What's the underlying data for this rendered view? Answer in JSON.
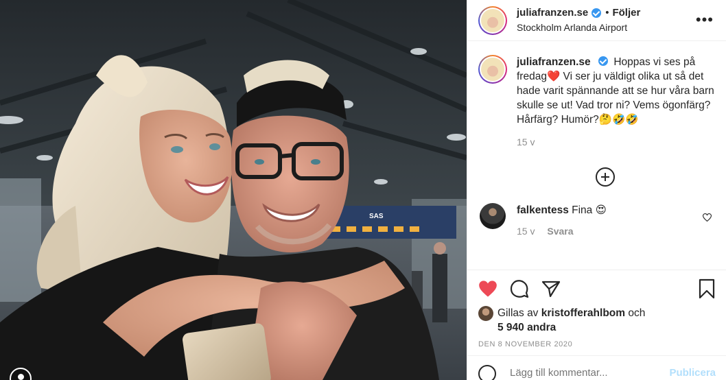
{
  "post": {
    "username": "juliafranzen.se",
    "separator": "•",
    "follow_label": "Följer",
    "location": "Stockholm Arlanda Airport",
    "more_icon": "more-options-icon"
  },
  "caption": {
    "username": "juliafranzen.se",
    "text": "Hoppas vi ses på fredag❤️ Vi ser ju väldigt olika ut så det hade varit spännande att se hur våra barn skulle se ut! Vad tror ni? Vems ögonfärg? Hårfärg? Humör?🤔🤣🤣",
    "time": "15 v"
  },
  "comments": [
    {
      "username": "falkentess",
      "text": "Fina 😍",
      "time": "15 v",
      "reply_label": "Svara"
    }
  ],
  "likes": {
    "prefix": "Gillas av",
    "user": "kristofferahlbom",
    "joiner": "och",
    "others": "5 940 andra"
  },
  "date": "DEN 8 NOVEMBER 2020",
  "add_comment": {
    "placeholder": "Lägg till kommentar...",
    "publish_label": "Publicera"
  },
  "photo_sign_text": "SAS",
  "colors": {
    "heart": "#ed4956",
    "verified": "#3897f0",
    "publish_disabled": "#b2dffc",
    "secondary_text": "#8e8e8e"
  }
}
